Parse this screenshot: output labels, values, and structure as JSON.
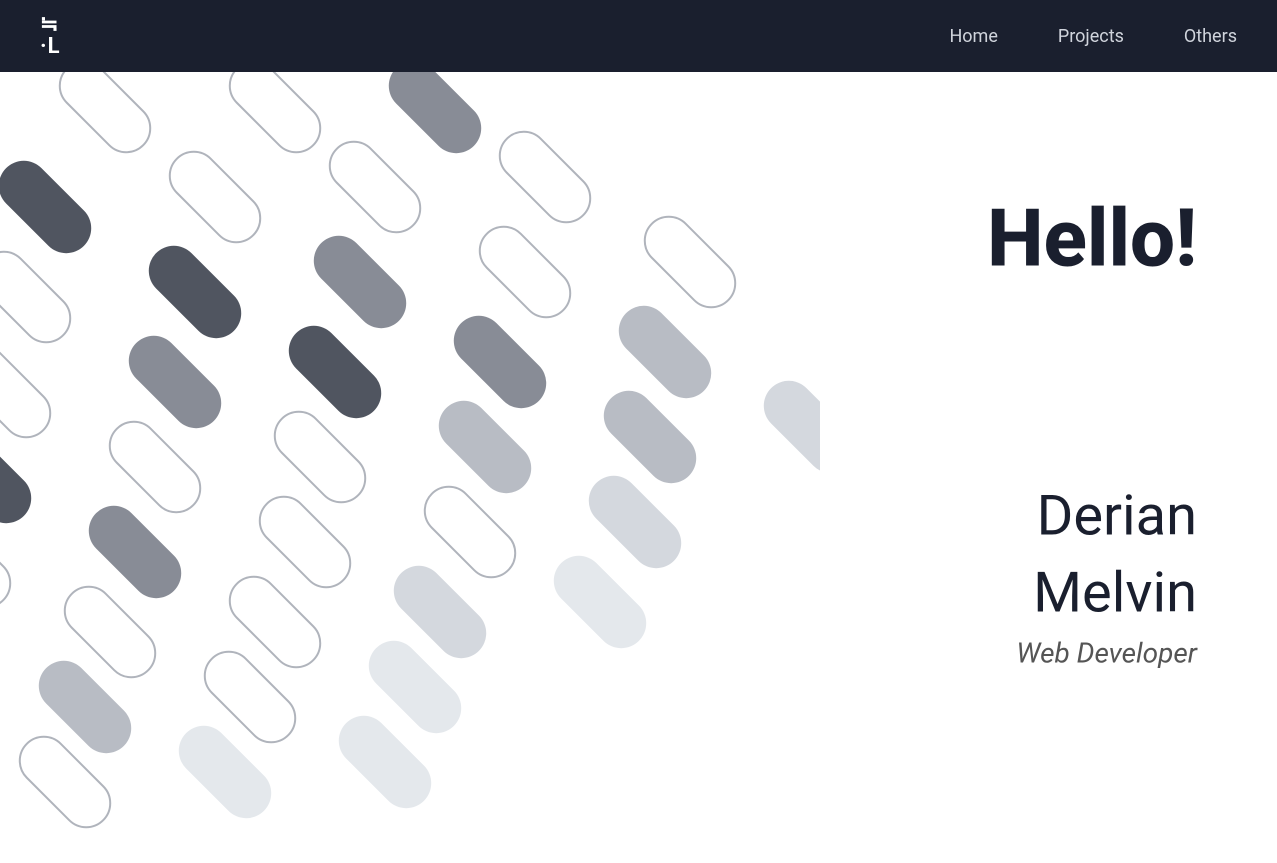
{
  "navbar": {
    "logo": "≒\n·L",
    "links": [
      {
        "label": "Home",
        "id": "home"
      },
      {
        "label": "Projects",
        "id": "projects"
      },
      {
        "label": "Others",
        "id": "others"
      }
    ]
  },
  "hero": {
    "greeting": "Hello!",
    "first_name": "Derian",
    "last_name": "Melvin",
    "title": "Web Developer"
  }
}
